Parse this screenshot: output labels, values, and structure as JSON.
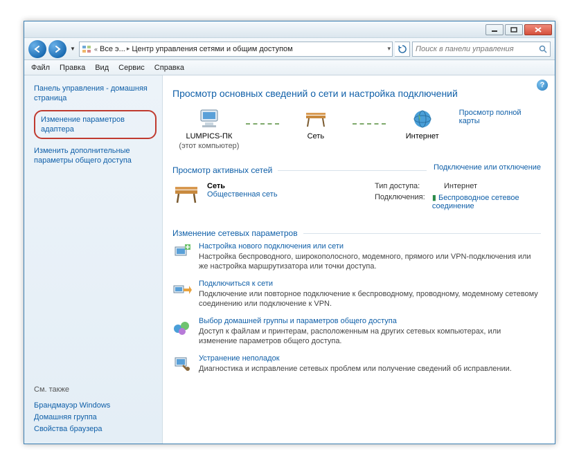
{
  "breadcrumb": {
    "seg1": "Все э...",
    "seg2": "Центр управления сетями и общим доступом"
  },
  "search": {
    "placeholder": "Поиск в панели управления"
  },
  "menu": {
    "file": "Файл",
    "edit": "Правка",
    "view": "Вид",
    "service": "Сервис",
    "help": "Справка"
  },
  "sidebar": {
    "home": "Панель управления - домашняя страница",
    "adapter": "Изменение параметров адаптера",
    "sharing": "Изменить дополнительные параметры общего доступа",
    "seealso": "См. также",
    "firewall": "Брандмауэр Windows",
    "homegroup": "Домашняя группа",
    "browser": "Свойства браузера"
  },
  "content": {
    "title": "Просмотр основных сведений о сети и настройка подключений",
    "fullmap": "Просмотр полной карты",
    "node_pc": "LUMPICS-ПК",
    "node_pc_sub": "(этот компьютер)",
    "node_net": "Сеть",
    "node_inet": "Интернет",
    "sec_active": "Просмотр активных сетей",
    "conn_disc": "Подключение или отключение",
    "net_name": "Сеть",
    "net_type": "Общественная сеть",
    "kv_access": "Тип доступа:",
    "kv_access_v": "Интернет",
    "kv_conn": "Подключения:",
    "kv_conn_v": "Беспроводное сетевое соединение",
    "sec_change": "Изменение сетевых параметров",
    "items": [
      {
        "t": "Настройка нового подключения или сети",
        "d": "Настройка беспроводного, широкополосного, модемного, прямого или VPN-подключения или же настройка маршрутизатора или точки доступа."
      },
      {
        "t": "Подключиться к сети",
        "d": "Подключение или повторное подключение к беспроводному, проводному, модемному сетевому соединению или подключение к VPN."
      },
      {
        "t": "Выбор домашней группы и параметров общего доступа",
        "d": "Доступ к файлам и принтерам, расположенным на других сетевых компьютерах, или изменение параметров общего доступа."
      },
      {
        "t": "Устранение неполадок",
        "d": "Диагностика и исправление сетевых проблем или получение сведений об исправлении."
      }
    ]
  }
}
